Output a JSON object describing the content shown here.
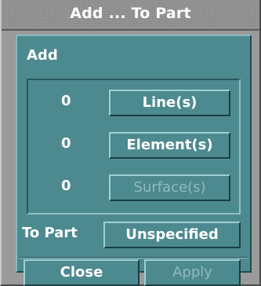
{
  "window": {
    "title": "Add ... To Part"
  },
  "add_section": {
    "label": "Add",
    "rows": [
      {
        "count": "0",
        "button": "Line(s)",
        "enabled": true
      },
      {
        "count": "0",
        "button": "Element(s)",
        "enabled": true
      },
      {
        "count": "0",
        "button": "Surface(s)",
        "enabled": false
      }
    ]
  },
  "to_part": {
    "label": "To Part",
    "value": "Unspecified"
  },
  "actions": {
    "close": "Close",
    "apply": "Apply",
    "apply_enabled": false
  }
}
